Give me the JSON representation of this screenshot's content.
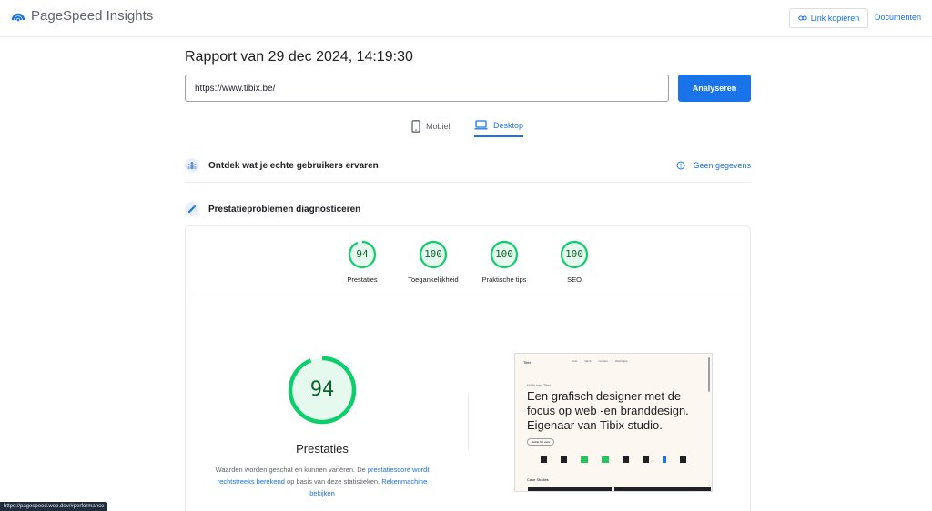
{
  "header": {
    "app_name": "PageSpeed Insights",
    "copy_link_label": "Link kopiëren",
    "docs_label": "Documenten"
  },
  "report": {
    "title": "Rapport van 29 dec 2024, 14:19:30",
    "url_value": "https://www.tibix.be/",
    "analyze_label": "Analyseren"
  },
  "tabs": {
    "mobile_label": "Mobiel",
    "desktop_label": "Desktop",
    "active": "Desktop"
  },
  "field_data": {
    "title": "Ontdek wat je echte gebruikers ervaren",
    "no_data_label": "Geen gegevens"
  },
  "diagnostics": {
    "title": "Prestatieproblemen diagnosticeren",
    "scores": [
      {
        "label": "Prestaties",
        "value": "94",
        "fraction": 0.94
      },
      {
        "label": "Toegankelijkheid",
        "value": "100",
        "fraction": 1.0
      },
      {
        "label": "Praktische tips",
        "value": "100",
        "fraction": 1.0
      },
      {
        "label": "SEO",
        "value": "100",
        "fraction": 1.0
      }
    ],
    "main_score": {
      "label": "Prestaties",
      "value": "94",
      "fraction": 0.94
    },
    "description": {
      "part1": "Waarden worden geschat en kunnen variëren. De ",
      "link1": "prestatiescore wordt rechtstreeks berekend",
      "part2": " op basis van deze statistieken. ",
      "link2": "Rekenmachine bekijken"
    }
  },
  "screenshot": {
    "logo": "Tibix",
    "nav_items": [
      "Over",
      "Werk",
      "Contact",
      "Werkwijze"
    ],
    "greeting": "Hi! Ik ben Tibix.",
    "headline": "Een grafisch designer met de focus op web -en branddesign. Eigenaar van Tibix studio.",
    "cta": "Bekijk het werk",
    "case_studies": "Case Studies"
  },
  "status_bar": {
    "url": "https://pagespeed.web.dev/#performance"
  },
  "colors": {
    "accent": "#1a73e8",
    "pass": "#0cce6b",
    "pass_text": "#0d652d"
  }
}
